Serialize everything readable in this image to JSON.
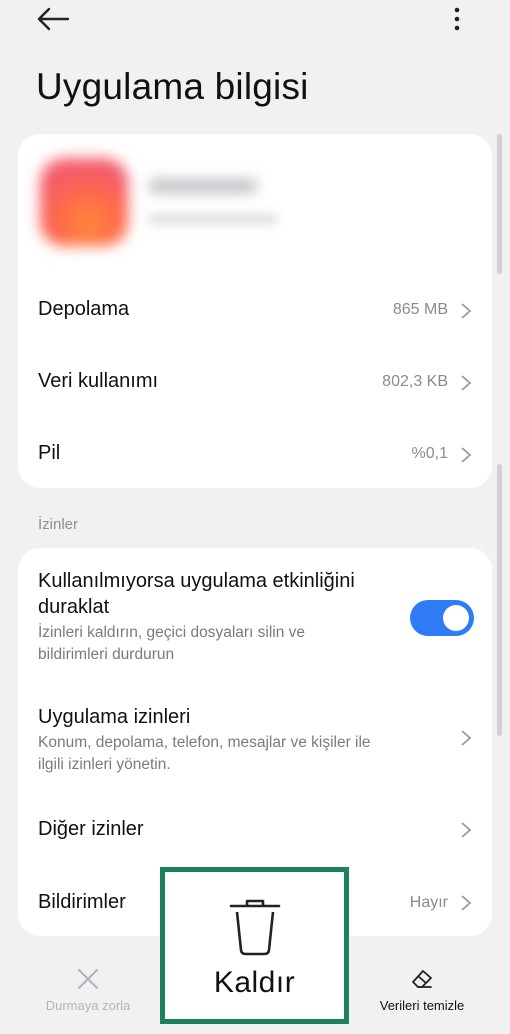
{
  "header": {
    "title": "Uygulama bilgisi",
    "back_icon": "arrow-left-icon",
    "more_icon": "more-vertical-icon"
  },
  "app_info": {
    "name_blurred": true
  },
  "info_rows": [
    {
      "title": "Depolama",
      "value": "865 MB"
    },
    {
      "title": "Veri kullanımı",
      "value": "802,3 KB"
    },
    {
      "title": "Pil",
      "value": "%0,1"
    }
  ],
  "permissions_section": {
    "label": "İzinler",
    "pause_activity": {
      "title_line1": "Kullanılmıyorsa uygulama etkinliğini",
      "title_line2": "duraklat",
      "subtitle_line1": "İzinleri kaldırın, geçici dosyaları silin ve",
      "subtitle_line2": "bildirimleri durdurun",
      "toggle_on": true
    },
    "app_permissions": {
      "title": "Uygulama izinleri",
      "subtitle_line1": "Konum, depolama, telefon, mesajlar ve kişiler ile",
      "subtitle_line2": "ilgili izinleri yönetin."
    },
    "other_permissions": {
      "title": "Diğer izinler"
    },
    "notifications": {
      "title": "Bildirimler",
      "value": "Hayır"
    }
  },
  "bottom_nav": {
    "force_stop": {
      "label": "Durmaya zorla",
      "icon": "close-icon"
    },
    "uninstall": {
      "label": "Kaldır",
      "icon": "trash-icon"
    },
    "clear_data": {
      "label": "Verileri temizle",
      "icon": "eraser-icon"
    }
  },
  "colors": {
    "accent": "#2f7bf5",
    "highlight_border": "#1d8060",
    "background": "#f1f1f3"
  }
}
